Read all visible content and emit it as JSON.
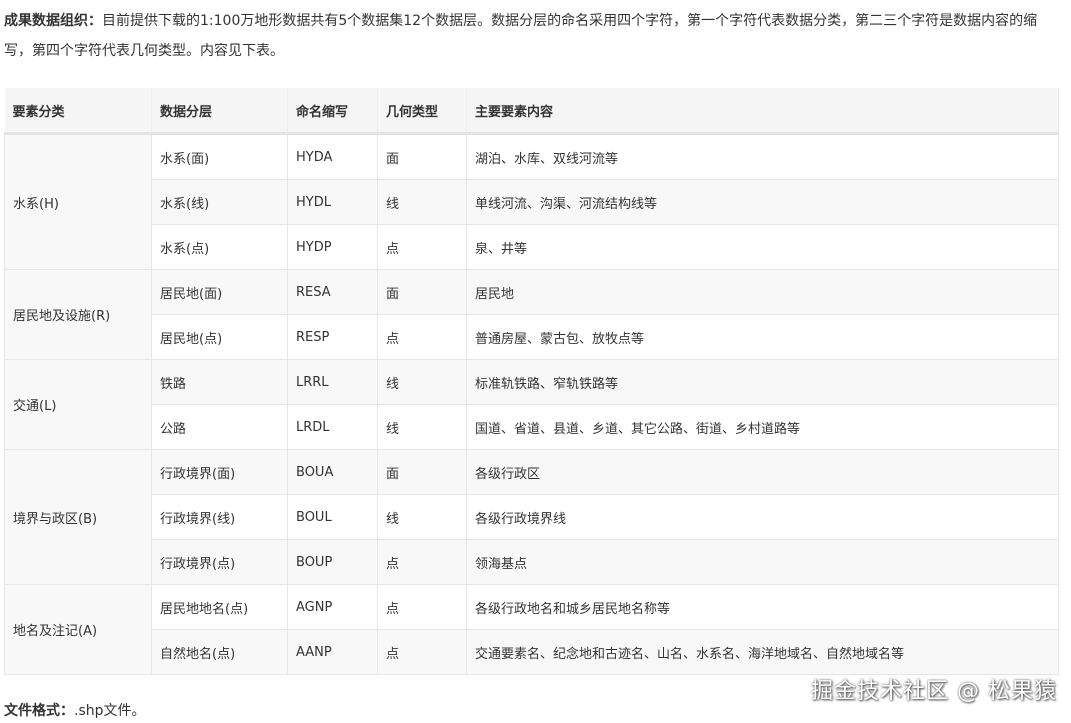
{
  "intro": {
    "label": "成果数据组织：",
    "text": "目前提供下载的1:100万地形数据共有5个数据集12个数据层。数据分层的命名采用四个字符，第一个字符代表数据分类，第二三个字符是数据内容的缩写，第四个字符代表几何类型。内容见下表。"
  },
  "table": {
    "headers": [
      "要素分类",
      "数据分层",
      "命名缩写",
      "几何类型",
      "主要要素内容"
    ],
    "groups": [
      {
        "category": "水系(H)",
        "rows": [
          [
            "水系(面)",
            "HYDA",
            "面",
            "湖泊、水库、双线河流等"
          ],
          [
            "水系(线)",
            "HYDL",
            "线",
            "单线河流、沟渠、河流结构线等"
          ],
          [
            "水系(点)",
            "HYDP",
            "点",
            "泉、井等"
          ]
        ]
      },
      {
        "category": "居民地及设施(R)",
        "rows": [
          [
            "居民地(面)",
            "RESA",
            "面",
            "居民地"
          ],
          [
            "居民地(点)",
            "RESP",
            "点",
            "普通房屋、蒙古包、放牧点等"
          ]
        ]
      },
      {
        "category": "交通(L)",
        "rows": [
          [
            "铁路",
            "LRRL",
            "线",
            "标准轨铁路、窄轨铁路等"
          ],
          [
            "公路",
            "LRDL",
            "线",
            "国道、省道、县道、乡道、其它公路、街道、乡村道路等"
          ]
        ]
      },
      {
        "category": "境界与政区(B)",
        "rows": [
          [
            "行政境界(面)",
            "BOUA",
            "面",
            "各级行政区"
          ],
          [
            "行政境界(线)",
            "BOUL",
            "线",
            "各级行政境界线"
          ],
          [
            "行政境界(点)",
            "BOUP",
            "点",
            "领海基点"
          ]
        ]
      },
      {
        "category": "地名及注记(A)",
        "rows": [
          [
            "居民地地名(点)",
            "AGNP",
            "点",
            "各级行政地名和城乡居民地名称等"
          ],
          [
            "自然地名(点)",
            "AANP",
            "点",
            "交通要素名、纪念地和古迹名、山名、水系名、海洋地域名、自然地域名等"
          ]
        ]
      }
    ]
  },
  "footer": {
    "label": "文件格式：",
    "text": ".shp文件。"
  },
  "watermark": "掘金技术社区 @ 松果猿"
}
